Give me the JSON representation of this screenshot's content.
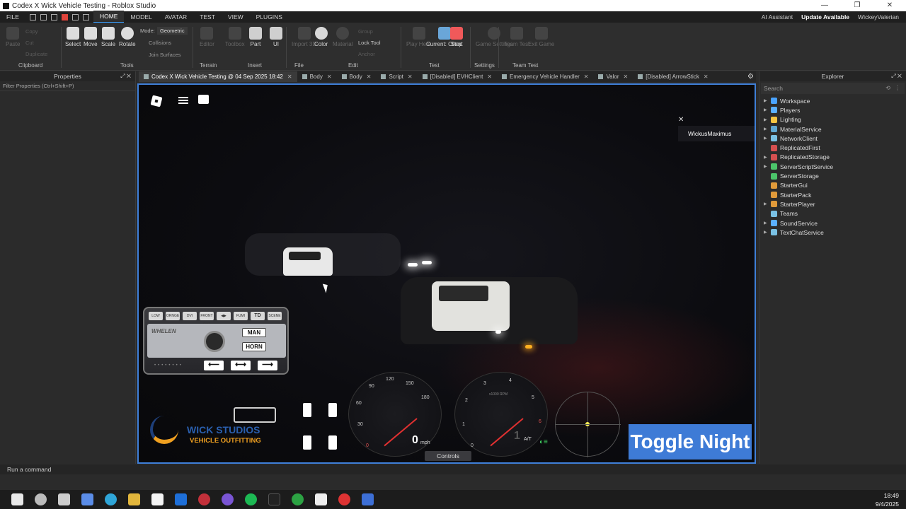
{
  "window": {
    "title": "Codex X Wick Vehicle Testing - Roblox Studio",
    "minimize": "—",
    "maximize": "❐",
    "close": "✕"
  },
  "menubar": {
    "items": [
      "FILE",
      "HOME",
      "MODEL",
      "AVATAR",
      "TEST",
      "VIEW",
      "PLUGINS"
    ],
    "ai_assistant": "AI Assistant",
    "update": "Update Available",
    "user": "WickeyValerian"
  },
  "ribbon": {
    "clipboard": {
      "paste": "Paste",
      "copy": "Copy",
      "cut": "Cut",
      "duplicate": "Duplicate",
      "label": "Clipboard"
    },
    "tools": {
      "select": "Select",
      "move": "Move",
      "scale": "Scale",
      "rotate": "Rotate",
      "mode_label": "Mode:",
      "mode_value": "Geometric",
      "collisions": "Collisions",
      "join_surfaces": "Join Surfaces",
      "label": "Tools"
    },
    "terrain": {
      "editor": "Editor",
      "toolbox": "Toolbox",
      "label": "Terrain"
    },
    "insert": {
      "part": "Part",
      "ui": "UI",
      "label": "Insert"
    },
    "file": {
      "import3d": "Import 3D",
      "label": "File"
    },
    "edit": {
      "color": "Color",
      "material": "Material",
      "group": "Group",
      "lock_tool": "Lock Tool",
      "anchor": "Anchor",
      "label": "Edit"
    },
    "test": {
      "play_here": "Play Here",
      "current_client": "Current: Client",
      "stop": "Stop",
      "label": "Test"
    },
    "settings": {
      "game_settings": "Game Settings",
      "label": "Settings"
    },
    "team_test": {
      "team_test": "Team Test",
      "exit_game": "Exit Game",
      "label": "Team Test"
    }
  },
  "properties": {
    "title": "Properties",
    "filter": "Filter Properties (Ctrl+Shift+P)"
  },
  "tabs": [
    {
      "label": "Codex X Wick Vehicle Testing @ 04 Sep 2025 18:42",
      "active": true
    },
    {
      "label": "Body"
    },
    {
      "label": "Body"
    },
    {
      "label": "Script"
    },
    {
      "label": "[Disabled] EVHClient"
    },
    {
      "label": "Emergency Vehicle Handler"
    },
    {
      "label": "Valor"
    },
    {
      "label": "[Disabled] ArrowStick"
    }
  ],
  "viewport": {
    "player_name": "WickusMaximus",
    "whelen": {
      "top_buttons": [
        "LOW",
        "ORNGE",
        "DVI",
        "FRONT CUT",
        "◀▶",
        "FUMI",
        "TD",
        "SCENE"
      ],
      "brand": "WHELEN",
      "man": "MAN",
      "horn": "HORN",
      "arrows": [
        "⟵",
        "⟷",
        "⟶"
      ]
    },
    "wick": {
      "title": "WICK STUDIOS",
      "subtitle": "VEHICLE OUTFITTING"
    },
    "speedometer": {
      "ticks": [
        "30",
        "60",
        "90",
        "120",
        "150",
        "180"
      ],
      "zero": "0",
      "value": "0",
      "unit": "mph"
    },
    "tachometer": {
      "ticks": [
        "0",
        "1",
        "2",
        "3",
        "4",
        "5",
        "6"
      ],
      "unit": "x1000 RPM"
    },
    "gear": "1",
    "trans": "A/T",
    "controls": "Controls",
    "toggle_night": "Toggle Night"
  },
  "explorer": {
    "title": "Explorer",
    "search_placeholder": "Search",
    "items": [
      {
        "label": "Workspace",
        "arrow": "▶",
        "color": "#4aa3ff"
      },
      {
        "label": "Players",
        "arrow": "▶",
        "color": "#5bb0ff"
      },
      {
        "label": "Lighting",
        "arrow": "▶",
        "color": "#f5c542"
      },
      {
        "label": "MaterialService",
        "arrow": "▶",
        "color": "#5fa8d3"
      },
      {
        "label": "NetworkClient",
        "arrow": "▶",
        "color": "#7ac1e4"
      },
      {
        "label": "ReplicatedFirst",
        "arrow": "",
        "color": "#d45050"
      },
      {
        "label": "ReplicatedStorage",
        "arrow": "▶",
        "color": "#d45050"
      },
      {
        "label": "ServerScriptService",
        "arrow": "▶",
        "color": "#4cc46a"
      },
      {
        "label": "ServerStorage",
        "arrow": "",
        "color": "#4cc46a"
      },
      {
        "label": "StarterGui",
        "arrow": "",
        "color": "#e09a3a"
      },
      {
        "label": "StarterPack",
        "arrow": "",
        "color": "#e09a3a"
      },
      {
        "label": "StarterPlayer",
        "arrow": "▶",
        "color": "#e09a3a"
      },
      {
        "label": "Teams",
        "arrow": "",
        "color": "#7ac1e4"
      },
      {
        "label": "SoundService",
        "arrow": "▶",
        "color": "#5bb0ff"
      },
      {
        "label": "TextChatService",
        "arrow": "▶",
        "color": "#7ac1e4"
      }
    ]
  },
  "command_bar": {
    "placeholder": "Run a command"
  },
  "taskbar": {
    "time": "18:49",
    "date": "9/4/2025"
  },
  "colors": {
    "accent": "#3e7bd6",
    "stop": "#f0595a",
    "viewport_border": "#3f7fd8"
  }
}
